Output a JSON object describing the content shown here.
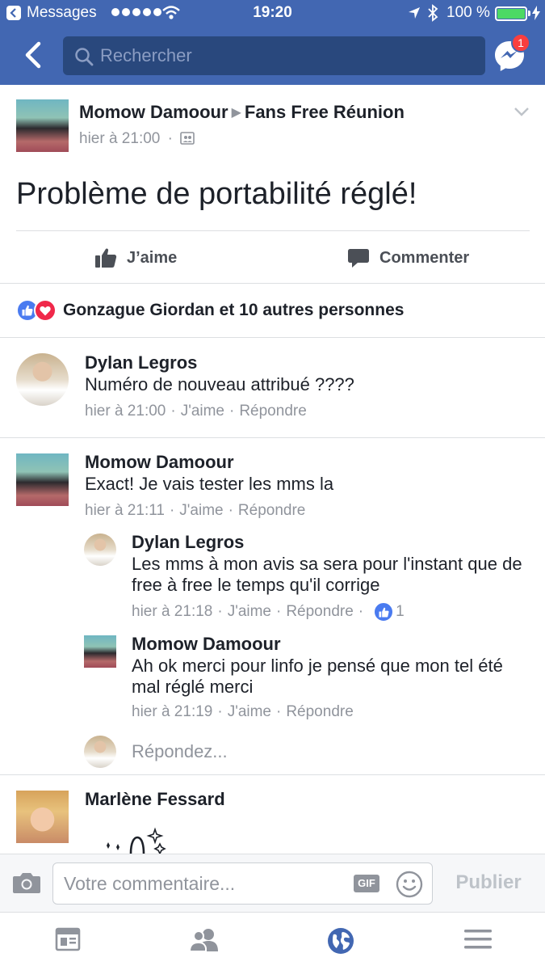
{
  "status_bar": {
    "back_app": "Messages",
    "time": "19:20",
    "battery": "100 %",
    "signal_bars": 5,
    "battery_level": 1.0,
    "battery_color": "#4cd964"
  },
  "header": {
    "search_placeholder": "Rechercher",
    "messenger_badge": "1",
    "brand_color": "#4267b2",
    "icons": [
      "back-chevron-icon",
      "search-icon",
      "messenger-icon"
    ]
  },
  "post": {
    "author": "Momow Damoour",
    "group": "Fans Free Réunion",
    "time": "hier à 21:00",
    "text": "Problème de portabilité réglé!",
    "like_label": "J’aime",
    "comment_label": "Commenter",
    "reactions_summary": "Gonzague Giordan et 10 autres personnes"
  },
  "comments": [
    {
      "name": "Dylan Legros",
      "text": "Numéro de nouveau attribué ????",
      "time": "hier à 21:00",
      "like": "J'aime",
      "reply": "Répondre"
    },
    {
      "name": "Momow Damoour",
      "text": "Exact! Je vais tester les mms la",
      "time": "hier à 21:11",
      "like": "J'aime",
      "reply": "Répondre",
      "replies": [
        {
          "name": "Dylan Legros",
          "text": "Les mms à mon avis sa sera pour l'instant que de free à free le temps qu'il corrige",
          "time": "hier à 21:18",
          "like": "J'aime",
          "reply": "Répondre",
          "reaction_count": "1"
        },
        {
          "name": "Momow Damoour",
          "text": "Ah ok merci pour linfo je pensé que mon tel été mal réglé merci",
          "time": "hier à 21:19",
          "like": "J'aime",
          "reply": "Répondre"
        }
      ],
      "reply_prompt": "Répondez..."
    },
    {
      "name": "Marlène Fessard"
    }
  ],
  "composer": {
    "placeholder": "Votre commentaire...",
    "gif_label": "GIF",
    "publish_label": "Publier"
  },
  "tabbar": {
    "tabs": [
      "news-feed-icon",
      "friends-icon",
      "notifications-globe-icon",
      "menu-icon"
    ],
    "active_tab_color": "#4267b2"
  }
}
